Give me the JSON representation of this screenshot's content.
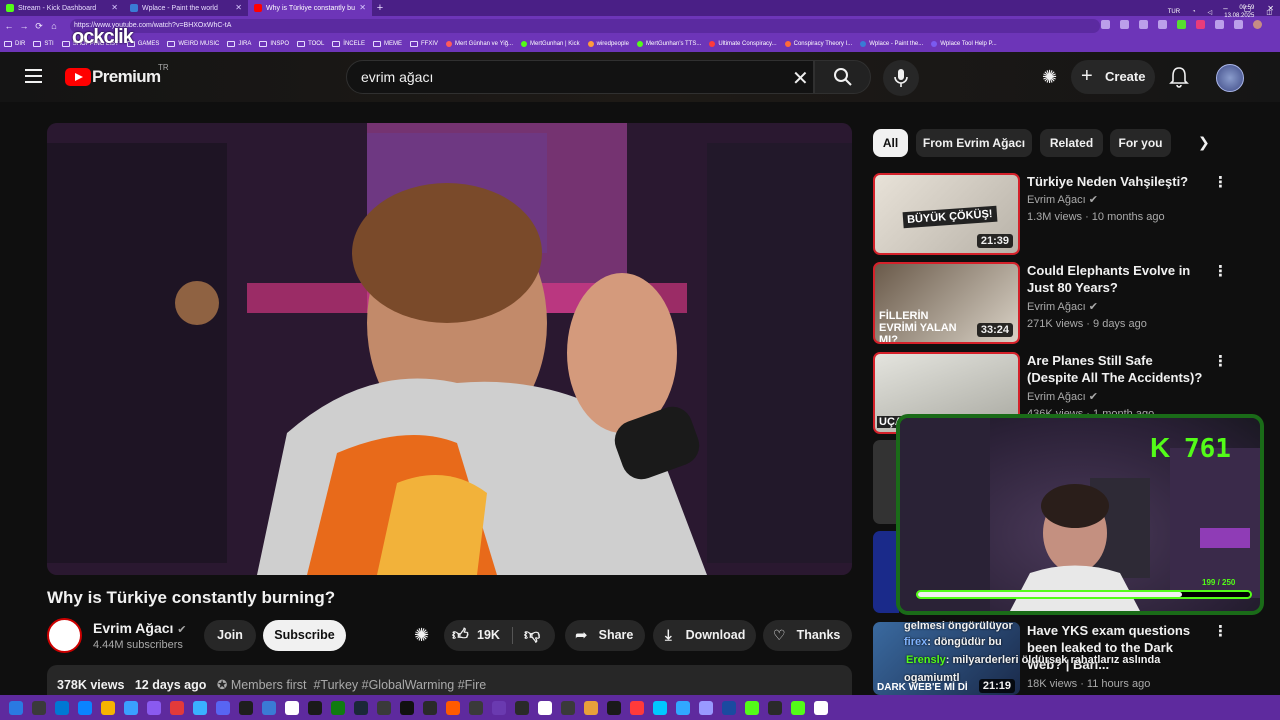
{
  "browser": {
    "tabs": [
      {
        "title": "Stream - Kick Dashboard",
        "color": "#53fc18",
        "active": false
      },
      {
        "title": "Wplace - Paint the world",
        "color": "#3a7bd5",
        "active": false
      },
      {
        "title": "Why is Türkiye constantly bu",
        "color": "#ff0000",
        "active": true
      }
    ],
    "url": "https://www.youtube.com/watch?v=BHXOxWhC-tA",
    "bookmarks": [
      "DIR",
      "STI",
      "SHOPPING LIST",
      "GAMES",
      "WEIRD MUSIC",
      "JIRA",
      "INSPO",
      "TOOL",
      "İNCELE",
      "MEME",
      "FFXIV",
      "Mert Günhan ve Yiğ...",
      "MertGunhan | Kick",
      "wiredpeople",
      "MertGunhan's TTS...",
      "Ultimate Conspiracy...",
      "Conspiracy Theory I...",
      "Wplace - Paint the...",
      "Wplace Tool Help P..."
    ],
    "watermark": "ockclik"
  },
  "youtube": {
    "brand": "Premium",
    "country": "TR",
    "search_query": "evrim ağacı",
    "create_label": "Create"
  },
  "video": {
    "title": "Why is Türkiye constantly burning?",
    "channel": "Evrim Ağacı",
    "subscribers": "4.44M subscribers",
    "join_label": "Join",
    "subscribe_label": "Subscribe",
    "likes": "19K",
    "share_label": "Share",
    "download_label": "Download",
    "thanks_label": "Thanks",
    "views": "378K views",
    "age": "12 days ago",
    "members": "Members first",
    "tags": "#Turkey #GlobalWarming #Fire"
  },
  "chips": [
    "All",
    "From Evrim Ağacı",
    "Related",
    "For you"
  ],
  "related": [
    {
      "title": "Türkiye Neden Vahşileşti?",
      "channel": "Evrim Ağacı",
      "views": "1.3M views · 10 months ago",
      "duration": "21:39",
      "thumb_text": "BÜYÜK ÇÖKÜŞ!"
    },
    {
      "title": "Could Elephants Evolve in Just 80 Years?",
      "channel": "Evrim Ağacı",
      "views": "271K views · 9 days ago",
      "duration": "33:24",
      "thumb_text": "FİLLERİN EVRİMİ YALAN MI?"
    },
    {
      "title": "Are Planes Still Safe (Despite All The Accidents)?",
      "channel": "Evrim Ağacı",
      "views": "436K views · 1 month ago",
      "duration": "",
      "thumb_text": "UÇAK"
    },
    {
      "title": "Have YKS exam questions been leaked to the Dark Web? | Barı...",
      "channel": "",
      "views": "18K views · 11 hours ago",
      "duration": "21:19",
      "thumb_text": "DARK WEB'E Mİ Dİ"
    }
  ],
  "stream": {
    "kick_letter": "K",
    "viewer_count": "761",
    "xp_text": "199 / 250",
    "xp_fraction": 0.796,
    "chat": [
      {
        "name": "",
        "text": "gelmesi öngörülüyor"
      },
      {
        "name": "firex",
        "text": ": döngüdür bu"
      },
      {
        "name": "Erensly",
        "text": ": milyarderleri öldürsek rahatlarız aslında"
      },
      {
        "name": "",
        "text": "ogamiumtl"
      }
    ]
  },
  "taskbar": {
    "time": "00:59",
    "date": "13.08.2025",
    "lang": "TUR"
  }
}
